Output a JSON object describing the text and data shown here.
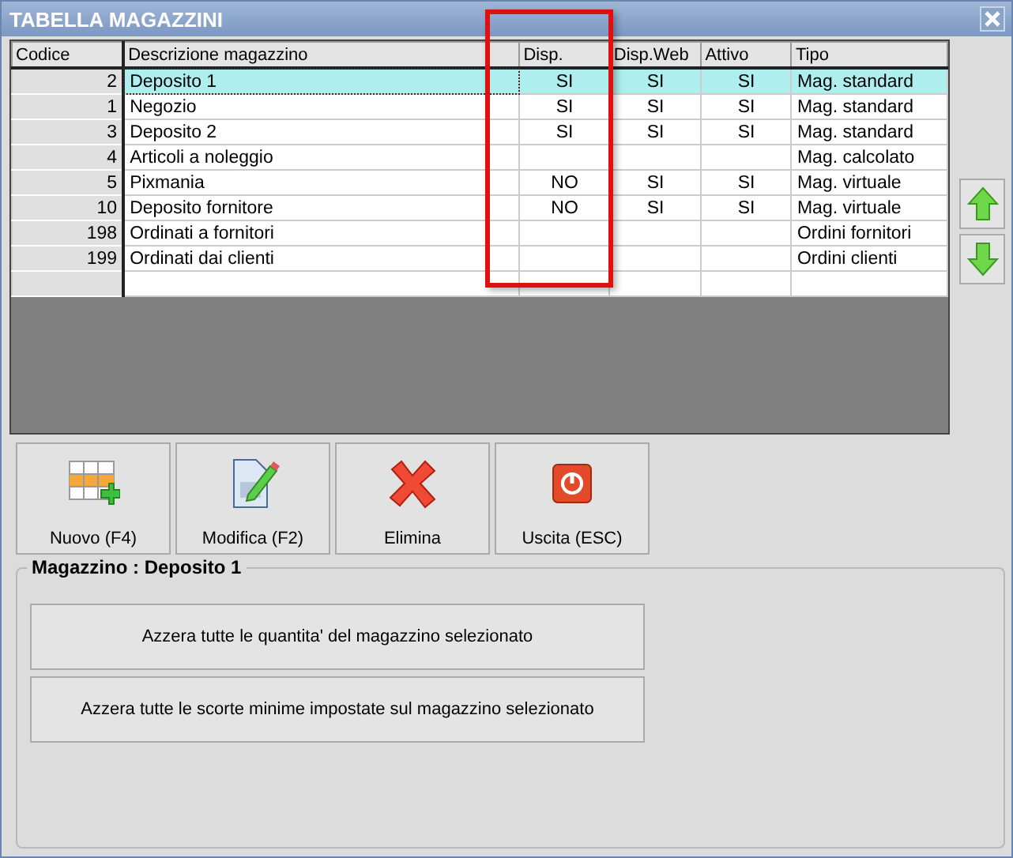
{
  "window": {
    "title": "TABELLA MAGAZZINI"
  },
  "table": {
    "columns": [
      "Codice",
      "Descrizione magazzino",
      "Disp.",
      "Disp.Web",
      "Attivo",
      "Tipo"
    ],
    "rows": [
      {
        "cells": [
          "2",
          "Deposito 1",
          "SI",
          "SI",
          "SI",
          "Mag. standard"
        ],
        "selected": true
      },
      {
        "cells": [
          "1",
          "Negozio",
          "SI",
          "SI",
          "SI",
          "Mag. standard"
        ],
        "selected": false
      },
      {
        "cells": [
          "3",
          "Deposito 2",
          "SI",
          "SI",
          "SI",
          "Mag. standard"
        ],
        "selected": false
      },
      {
        "cells": [
          "4",
          "Articoli a noleggio",
          "",
          "",
          "",
          "Mag. calcolato"
        ],
        "selected": false
      },
      {
        "cells": [
          "5",
          "Pixmania",
          "NO",
          "SI",
          "SI",
          "Mag. virtuale"
        ],
        "selected": false
      },
      {
        "cells": [
          "10",
          "Deposito fornitore",
          "NO",
          "SI",
          "SI",
          "Mag. virtuale"
        ],
        "selected": false
      },
      {
        "cells": [
          "198",
          "Ordinati a fornitori",
          "",
          "",
          "",
          "Ordini fornitori"
        ],
        "selected": false
      },
      {
        "cells": [
          "199",
          "Ordinati dai clienti",
          "",
          "",
          "",
          "Ordini clienti"
        ],
        "selected": false
      }
    ]
  },
  "toolbar": [
    {
      "kind": "new",
      "label": "Nuovo (F4)"
    },
    {
      "kind": "edit",
      "label": "Modifica (F2)"
    },
    {
      "kind": "delete",
      "label": "Elimina"
    },
    {
      "kind": "exit",
      "label": "Uscita (ESC)"
    }
  ],
  "group": {
    "title": "Magazzino : Deposito 1",
    "buttons": [
      "Azzera tutte le quantita' del magazzino selezionato",
      "Azzera tutte le scorte minime impostate sul magazzino selezionato"
    ]
  }
}
